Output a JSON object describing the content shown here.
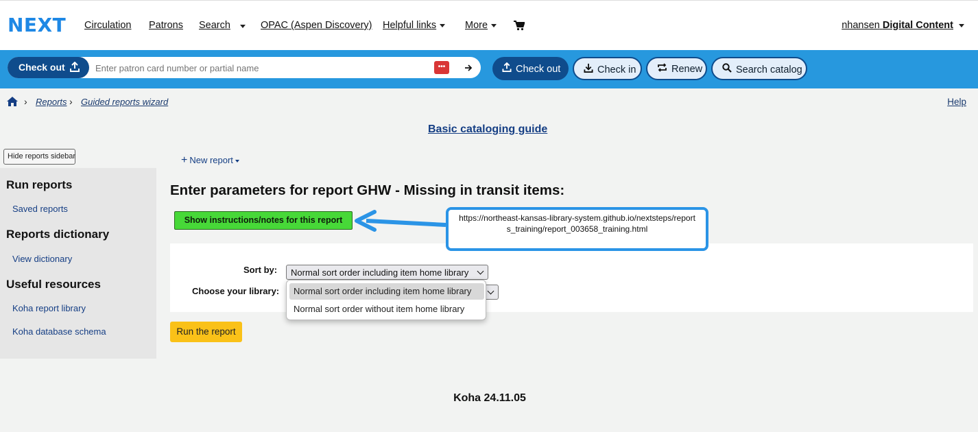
{
  "topnav": {
    "logo": "NEXT",
    "links": {
      "circulation": "Circulation",
      "patrons": "Patrons",
      "search": "Search",
      "opac": "OPAC (Aspen Discovery)",
      "helpful": "Helpful links",
      "more": "More"
    },
    "user_name": "nhansen",
    "user_branch": "Digital Content"
  },
  "searchbar": {
    "checkout_select": "Check out",
    "patron_placeholder": "Enter patron card number or partial name",
    "buttons": {
      "checkout": "Check out",
      "checkin": "Check in",
      "renew": "Renew",
      "search_catalog": "Search catalog"
    }
  },
  "breadcrumb": {
    "reports": "Reports",
    "guided": "Guided reports wizard"
  },
  "help_link": "Help",
  "guide_link": "Basic cataloging guide",
  "sidebar": {
    "hide_button": "Hide reports sidebar",
    "run_reports": "Run reports",
    "saved_reports": "Saved reports",
    "dictionary": "Reports dictionary",
    "view_dictionary": "View dictionary",
    "useful": "Useful resources",
    "koha_library": "Koha report library",
    "koha_schema": "Koha database schema"
  },
  "main": {
    "new_report": "New report",
    "title": "Enter parameters for report GHW - Missing in transit items:",
    "instructions_button": "Show instructions/notes for this report",
    "sort_label": "Sort by:",
    "sort_value": "Normal sort order including item home library",
    "library_label": "Choose your library:",
    "dropdown_options": [
      "Normal sort order including item home library",
      "Normal sort order without item home library"
    ],
    "run_button": "Run the report"
  },
  "annotation": {
    "url": "https://northeast-kansas-library-system.github.io/nextsteps/reports_training/report_003658_training.html"
  },
  "footer": "Koha 24.11.05",
  "colors": {
    "blue_bar": "#2798de",
    "dark_blue": "#0f4c8c",
    "green_button": "#47d838",
    "run_button": "#fac118",
    "annotation": "#2b94e6"
  }
}
